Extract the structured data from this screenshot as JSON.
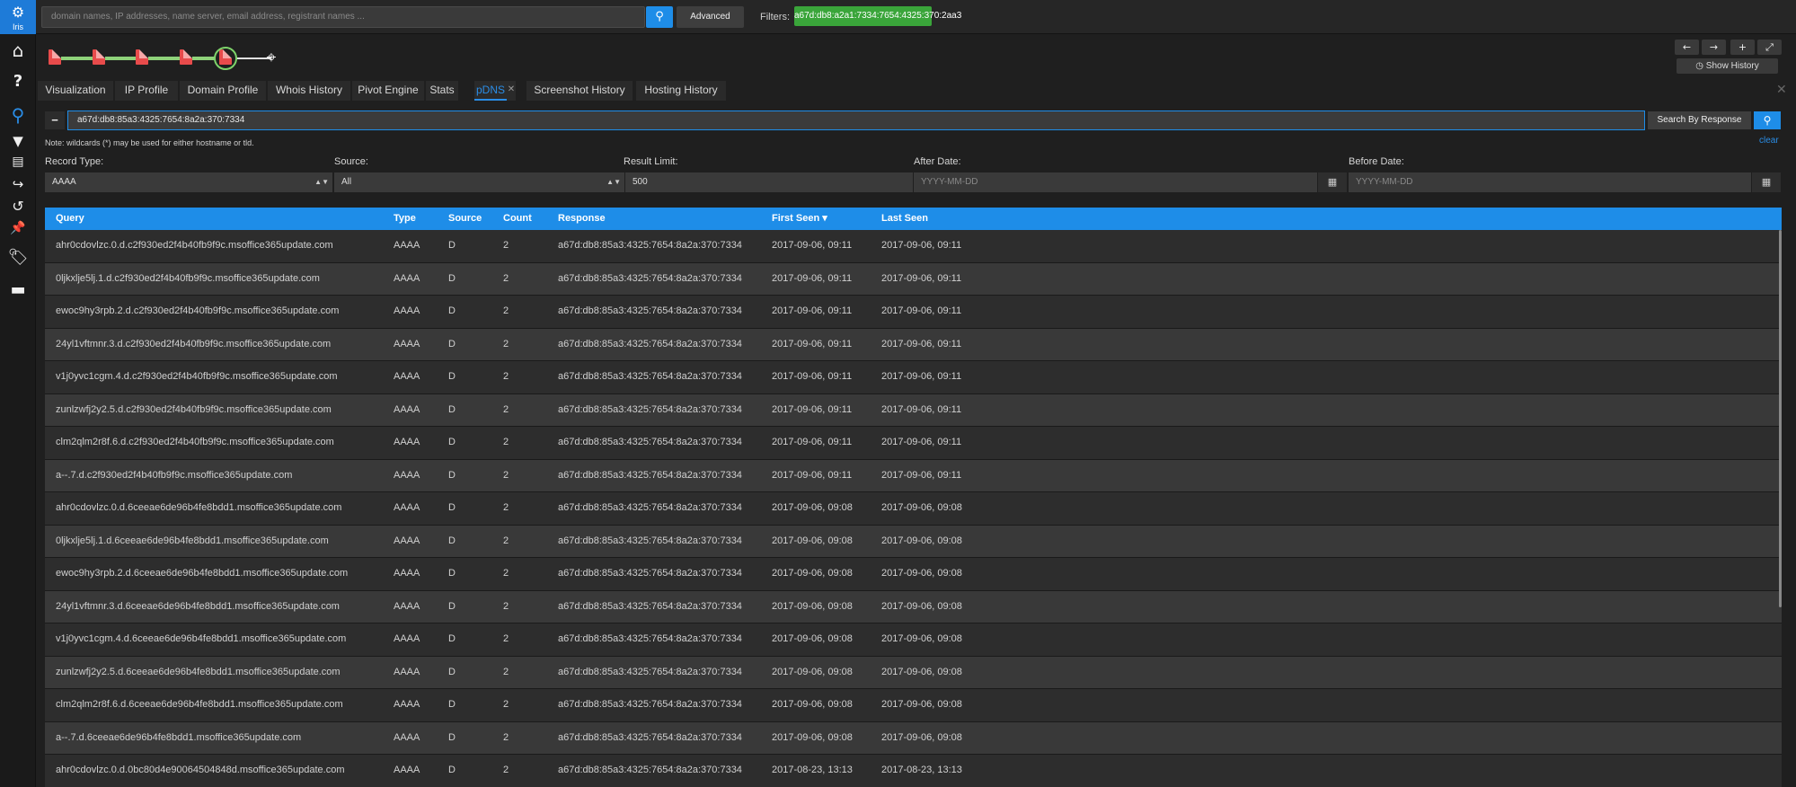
{
  "app": {
    "logo_text": "Iris"
  },
  "topbar": {
    "search_placeholder": "domain names, IP addresses, name server, email address, registrant names ...",
    "advanced_label": "Advanced",
    "filters_label": "Filters:",
    "filter_chip": "a67d:db8:a2a1:7334:7654:4325:370:2aa3"
  },
  "history": {
    "show_history_label": "Show History"
  },
  "tabs": [
    {
      "label": "Visualization"
    },
    {
      "label": "IP Profile"
    },
    {
      "label": "Domain Profile"
    },
    {
      "label": "Whois History"
    },
    {
      "label": "Pivot Engine"
    },
    {
      "label": "Stats"
    },
    {
      "label": "pDNS"
    },
    {
      "label": "Screenshot History"
    },
    {
      "label": "Hosting History"
    }
  ],
  "pdns": {
    "query_value": "a67d:db8:85a3:4325:7654:8a2a:370:7334",
    "search_by_response_label": "Search By Response",
    "note": "Note: wildcards (*) may be used for either hostname or tld.",
    "clear_label": "clear",
    "record_type_label": "Record Type:",
    "record_type_value": "AAAA",
    "source_label": "Source:",
    "source_value": "All",
    "result_limit_label": "Result Limit:",
    "result_limit_value": "500",
    "after_date_label": "After Date:",
    "after_date_placeholder": "YYYY-MM-DD",
    "before_date_label": "Before Date:",
    "before_date_placeholder": "YYYY-MM-DD"
  },
  "table": {
    "columns": [
      "Query",
      "Type",
      "Source",
      "Count",
      "Response",
      "First Seen",
      "Last Seen"
    ],
    "sort_indicator": "▾",
    "rows": [
      [
        "ahr0cdovlzc.0.d.c2f930ed2f4b40fb9f9c.msoffice365update.com",
        "AAAA",
        "D",
        "2",
        "a67d:db8:85a3:4325:7654:8a2a:370:7334",
        "2017-09-06, 09:11",
        "2017-09-06, 09:11"
      ],
      [
        "0ljkxlje5lj.1.d.c2f930ed2f4b40fb9f9c.msoffice365update.com",
        "AAAA",
        "D",
        "2",
        "a67d:db8:85a3:4325:7654:8a2a:370:7334",
        "2017-09-06, 09:11",
        "2017-09-06, 09:11"
      ],
      [
        "ewoc9hy3rpb.2.d.c2f930ed2f4b40fb9f9c.msoffice365update.com",
        "AAAA",
        "D",
        "2",
        "a67d:db8:85a3:4325:7654:8a2a:370:7334",
        "2017-09-06, 09:11",
        "2017-09-06, 09:11"
      ],
      [
        "24yl1vftmnr.3.d.c2f930ed2f4b40fb9f9c.msoffice365update.com",
        "AAAA",
        "D",
        "2",
        "a67d:db8:85a3:4325:7654:8a2a:370:7334",
        "2017-09-06, 09:11",
        "2017-09-06, 09:11"
      ],
      [
        "v1j0yvc1cgm.4.d.c2f930ed2f4b40fb9f9c.msoffice365update.com",
        "AAAA",
        "D",
        "2",
        "a67d:db8:85a3:4325:7654:8a2a:370:7334",
        "2017-09-06, 09:11",
        "2017-09-06, 09:11"
      ],
      [
        "zunlzwfj2y2.5.d.c2f930ed2f4b40fb9f9c.msoffice365update.com",
        "AAAA",
        "D",
        "2",
        "a67d:db8:85a3:4325:7654:8a2a:370:7334",
        "2017-09-06, 09:11",
        "2017-09-06, 09:11"
      ],
      [
        "clm2qlm2r8f.6.d.c2f930ed2f4b40fb9f9c.msoffice365update.com",
        "AAAA",
        "D",
        "2",
        "a67d:db8:85a3:4325:7654:8a2a:370:7334",
        "2017-09-06, 09:11",
        "2017-09-06, 09:11"
      ],
      [
        "a--.7.d.c2f930ed2f4b40fb9f9c.msoffice365update.com",
        "AAAA",
        "D",
        "2",
        "a67d:db8:85a3:4325:7654:8a2a:370:7334",
        "2017-09-06, 09:11",
        "2017-09-06, 09:11"
      ],
      [
        "ahr0cdovlzc.0.d.6ceeae6de96b4fe8bdd1.msoffice365update.com",
        "AAAA",
        "D",
        "2",
        "a67d:db8:85a3:4325:7654:8a2a:370:7334",
        "2017-09-06, 09:08",
        "2017-09-06, 09:08"
      ],
      [
        "0ljkxlje5lj.1.d.6ceeae6de96b4fe8bdd1.msoffice365update.com",
        "AAAA",
        "D",
        "2",
        "a67d:db8:85a3:4325:7654:8a2a:370:7334",
        "2017-09-06, 09:08",
        "2017-09-06, 09:08"
      ],
      [
        "ewoc9hy3rpb.2.d.6ceeae6de96b4fe8bdd1.msoffice365update.com",
        "AAAA",
        "D",
        "2",
        "a67d:db8:85a3:4325:7654:8a2a:370:7334",
        "2017-09-06, 09:08",
        "2017-09-06, 09:08"
      ],
      [
        "24yl1vftmnr.3.d.6ceeae6de96b4fe8bdd1.msoffice365update.com",
        "AAAA",
        "D",
        "2",
        "a67d:db8:85a3:4325:7654:8a2a:370:7334",
        "2017-09-06, 09:08",
        "2017-09-06, 09:08"
      ],
      [
        "v1j0yvc1cgm.4.d.6ceeae6de96b4fe8bdd1.msoffice365update.com",
        "AAAA",
        "D",
        "2",
        "a67d:db8:85a3:4325:7654:8a2a:370:7334",
        "2017-09-06, 09:08",
        "2017-09-06, 09:08"
      ],
      [
        "zunlzwfj2y2.5.d.6ceeae6de96b4fe8bdd1.msoffice365update.com",
        "AAAA",
        "D",
        "2",
        "a67d:db8:85a3:4325:7654:8a2a:370:7334",
        "2017-09-06, 09:08",
        "2017-09-06, 09:08"
      ],
      [
        "clm2qlm2r8f.6.d.6ceeae6de96b4fe8bdd1.msoffice365update.com",
        "AAAA",
        "D",
        "2",
        "a67d:db8:85a3:4325:7654:8a2a:370:7334",
        "2017-09-06, 09:08",
        "2017-09-06, 09:08"
      ],
      [
        "a--.7.d.6ceeae6de96b4fe8bdd1.msoffice365update.com",
        "AAAA",
        "D",
        "2",
        "a67d:db8:85a3:4325:7654:8a2a:370:7334",
        "2017-09-06, 09:08",
        "2017-09-06, 09:08"
      ],
      [
        "ahr0cdovlzc.0.d.0bc80d4e90064504848d.msoffice365update.com",
        "AAAA",
        "D",
        "2",
        "a67d:db8:85a3:4325:7654:8a2a:370:7334",
        "2017-08-23, 13:13",
        "2017-08-23, 13:13"
      ]
    ]
  },
  "colors": {
    "accent": "#1e8de8",
    "filter_chip": "#3aa53a",
    "timeline_doc": "#e84b4b",
    "timeline_link": "#8fd27a"
  }
}
